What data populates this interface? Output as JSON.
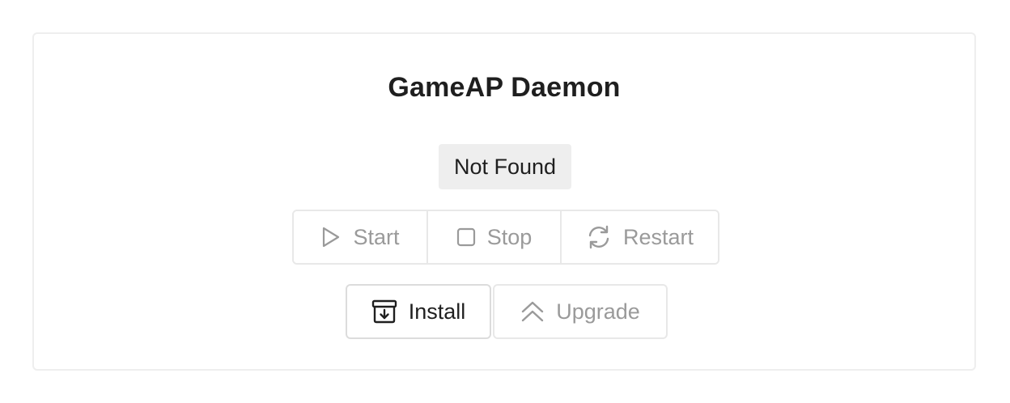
{
  "card": {
    "title": "GameAP Daemon",
    "status": "Not Found"
  },
  "actions": {
    "start_label": "Start",
    "stop_label": "Stop",
    "restart_label": "Restart",
    "install_label": "Install",
    "upgrade_label": "Upgrade"
  },
  "icons": {
    "start": "play-icon",
    "stop": "square-icon",
    "restart": "refresh-icon",
    "install": "archive-download-icon",
    "upgrade": "double-chevron-up-icon"
  },
  "colors": {
    "text": "#1f1f1f",
    "disabled_text": "#9a9a9a",
    "badge_bg": "#eeeeee",
    "border": "#e8e8e8"
  }
}
